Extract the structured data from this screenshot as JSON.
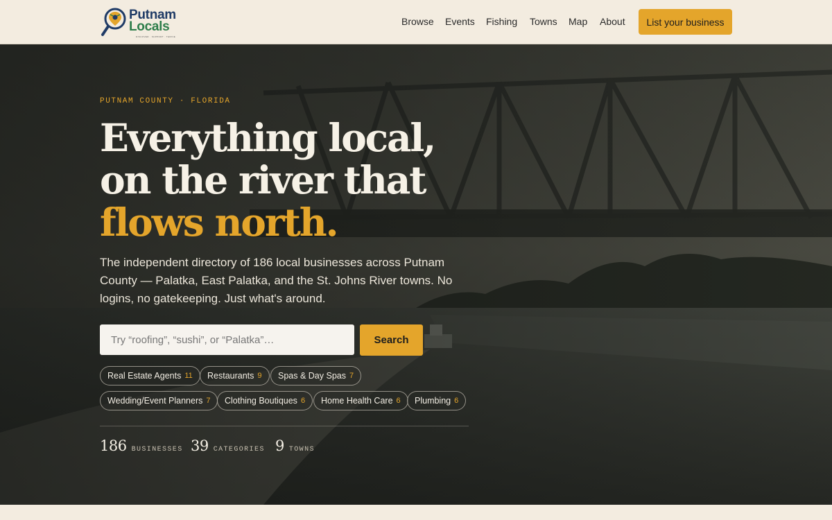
{
  "header": {
    "logo": {
      "line1": "Putnam",
      "line2": "Locals",
      "tagline": "DISCOVER · SUPPORT · THRIVE",
      "icon": "magnifier-pin-icon"
    },
    "nav": [
      "Browse",
      "Events",
      "Fishing",
      "Towns",
      "Map",
      "About"
    ],
    "cta_label": "List your business"
  },
  "hero": {
    "eyebrow": "PUTNAM COUNTY · FLORIDA",
    "headline": {
      "line1": "Everything local,",
      "line2": "on the river that",
      "line3": "flows north."
    },
    "lede": "The independent directory of 186 local businesses across Putnam County — Palatka, East Palatka, and the St. Johns River towns. No logins, no gatekeeping. Just what's around.",
    "search": {
      "placeholder": "Try “roofing”, “sushi”, or “Palatka”…",
      "button_label": "Search",
      "icon": "search-icon"
    },
    "chips": [
      {
        "label": "Real Estate Agents",
        "count": "11"
      },
      {
        "label": "Restaurants",
        "count": "9"
      },
      {
        "label": "Spas & Day Spas",
        "count": "7"
      },
      {
        "label": "Wedding/Event Planners",
        "count": "7"
      },
      {
        "label": "Clothing Boutiques",
        "count": "6"
      },
      {
        "label": "Home Health Care",
        "count": "6"
      },
      {
        "label": "Plumbing",
        "count": "6"
      }
    ],
    "stats": [
      {
        "number": "186",
        "label": "BUSINESSES"
      },
      {
        "number": "39",
        "label": "CATEGORIES"
      },
      {
        "number": "9",
        "label": "TOWNS"
      }
    ]
  },
  "colors": {
    "accent": "#e4a52b",
    "background": "#f3ece0",
    "hero_text": "#f6f1e6"
  }
}
